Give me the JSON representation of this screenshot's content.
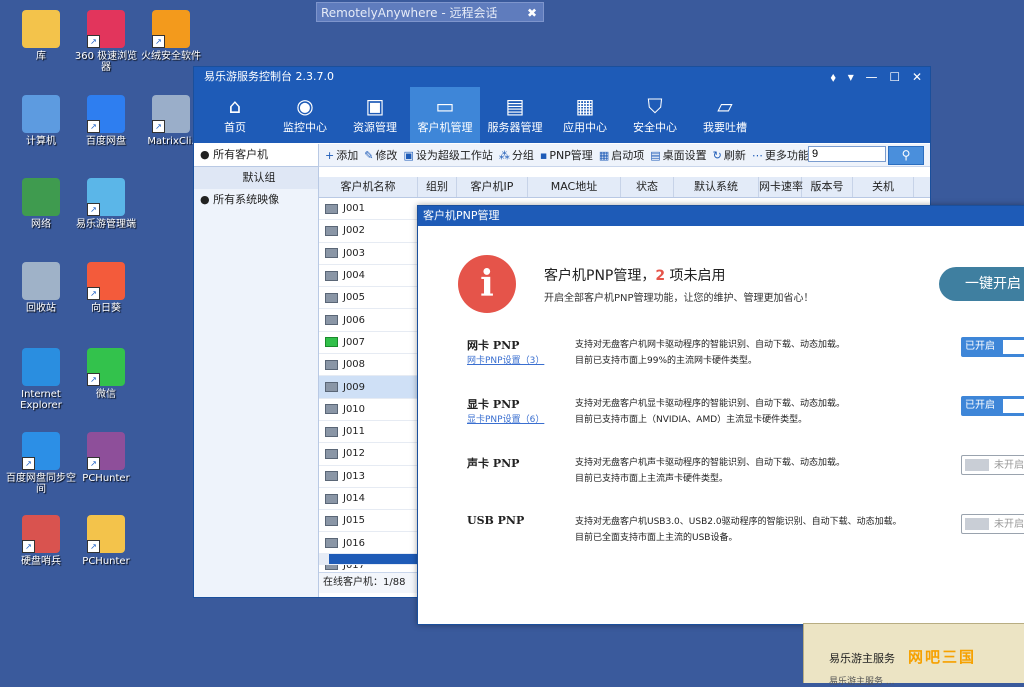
{
  "remote_bar": {
    "title": "RemotelyAnywhere - 远程会话",
    "close": "✖"
  },
  "desktop_icons": [
    {
      "name": "library",
      "label": "库",
      "icon": "folder-icon",
      "color": "#f3c34b"
    },
    {
      "name": "360-browser",
      "label": "360 极速浏览器",
      "icon": "browser-360-icon",
      "color": "#e2355c"
    },
    {
      "name": "huorong",
      "label": "火绒安全软件",
      "icon": "shield-icon",
      "color": "#f39a1c"
    },
    {
      "name": "computer",
      "label": "计算机",
      "icon": "computer-icon",
      "color": "#5d9be0"
    },
    {
      "name": "baidu-disk",
      "label": "百度网盘",
      "icon": "cloud-icon",
      "color": "#2e7ef0"
    },
    {
      "name": "matrix",
      "label": "MatrixCli.",
      "icon": "disc-icon",
      "color": "#9aaec9"
    },
    {
      "name": "network",
      "label": "网络",
      "icon": "globe-icon",
      "color": "#3f9b4f"
    },
    {
      "name": "yileyou-manager",
      "label": "易乐游管理端",
      "icon": "network-icon",
      "color": "#5bb6e8"
    },
    {
      "name": "recycle",
      "label": "回收站",
      "icon": "trash-icon",
      "color": "#9fb2c8"
    },
    {
      "name": "xiangrikui",
      "label": "向日葵",
      "icon": "sunflower-icon",
      "color": "#f35b3b"
    },
    {
      "name": "ie",
      "label": "Internet Explorer",
      "icon": "ie-icon",
      "color": "#2a8ee0"
    },
    {
      "name": "wechat",
      "label": "微信",
      "icon": "wechat-icon",
      "color": "#33c24c"
    },
    {
      "name": "baidu-sync",
      "label": "百度网盘同步空间",
      "icon": "sync-icon",
      "color": "#2c8fe6"
    },
    {
      "name": "pchunter1",
      "label": "PCHunter",
      "icon": "archive-icon",
      "color": "#8e4f9a"
    },
    {
      "name": "hdd",
      "label": "硬盘哨兵",
      "icon": "hdd-icon",
      "color": "#d9534f"
    },
    {
      "name": "pchunter2",
      "label": "PCHunter",
      "icon": "folder-icon",
      "color": "#f3c34b"
    }
  ],
  "console": {
    "title": "易乐游服务控制台 2.3.7.0",
    "window_controls": "⬧ ▾ — ☐ ✕",
    "nav": [
      {
        "label": "首页",
        "icon": "⌂"
      },
      {
        "label": "监控中心",
        "icon": "◉"
      },
      {
        "label": "资源管理",
        "icon": "▣"
      },
      {
        "label": "客户机管理",
        "icon": "▭"
      },
      {
        "label": "服务器管理",
        "icon": "▤"
      },
      {
        "label": "应用中心",
        "icon": "▦"
      },
      {
        "label": "安全中心",
        "icon": "⛉"
      },
      {
        "label": "我要吐槽",
        "icon": "▱"
      }
    ],
    "sidebar": {
      "all_clients": "所有客户机",
      "default_group": "默认组",
      "all_images": "所有系统映像"
    },
    "toolbar": {
      "add": "添加",
      "edit": "修改",
      "super": "设为超级工作站",
      "group": "分组",
      "pnp": "PNP管理",
      "startup": "启动项",
      "desktop": "桌面设置",
      "refresh": "刷新",
      "more": "更多功能",
      "search_value": "9"
    },
    "columns": [
      "客户机名称",
      "组别",
      "客户机IP",
      "MAC地址",
      "状态",
      "默认系统",
      "网卡速率",
      "版本号",
      "关机"
    ],
    "clients": [
      {
        "name": "J001",
        "online": false
      },
      {
        "name": "J002",
        "online": false
      },
      {
        "name": "J003",
        "online": false
      },
      {
        "name": "J004",
        "online": false
      },
      {
        "name": "J005",
        "online": false
      },
      {
        "name": "J006",
        "online": false
      },
      {
        "name": "J007",
        "online": true
      },
      {
        "name": "J008",
        "online": false
      },
      {
        "name": "J009",
        "online": false
      },
      {
        "name": "J010",
        "online": false
      },
      {
        "name": "J011",
        "online": false
      },
      {
        "name": "J012",
        "online": false
      },
      {
        "name": "J013",
        "online": false
      },
      {
        "name": "J014",
        "online": false
      },
      {
        "name": "J015",
        "online": false
      },
      {
        "name": "J016",
        "online": false
      },
      {
        "name": "J017",
        "online": false
      }
    ],
    "selected_client": "J009",
    "status": "在线客户机：1/88"
  },
  "pnp_dialog": {
    "title": "客户机PNP管理",
    "heading_prefix": "客户机PNP管理，",
    "heading_count": "2",
    "heading_suffix": " 项未启用",
    "subtitle": "开启全部客户机PNP管理功能，让您的维护、管理更加省心！",
    "enable_all": "一键开启",
    "items": [
      {
        "name": "网卡 PNP",
        "link": "网卡PNP设置（3）",
        "desc1": "支持对无盘客户机网卡驱动程序的智能识别、自动下载、动态加载。",
        "desc2": "目前已支持市面上99%的主流网卡硬件类型。",
        "state": "已开启",
        "on": true
      },
      {
        "name": "显卡 PNP",
        "link": "显卡PNP设置（6）",
        "desc1": "支持对无盘客户机显卡驱动程序的智能识别、自动下载、动态加载。",
        "desc2": "目前已支持市面上（NVIDIA、AMD）主流显卡硬件类型。",
        "state": "已开启",
        "on": true
      },
      {
        "name": "声卡 PNP",
        "link": "",
        "desc1": "支持对无盘客户机声卡驱动程序的智能识别、自动下载、动态加载。",
        "desc2": "目前已支持市面上主流声卡硬件类型。",
        "state": "未开启",
        "on": false
      },
      {
        "name": "USB PNP",
        "link": "",
        "desc1": "支持对无盘客户机USB3.0、USB2.0驱动程序的智能识别、自动下载、动态加载。",
        "desc2": "目前已全面支持市面上主流的USB设备。",
        "state": "未开启",
        "on": false
      }
    ]
  },
  "service_window": {
    "label": "易乐游主服务",
    "logo": "网吧三国",
    "cut_text": "易乐游主服务 ..."
  }
}
